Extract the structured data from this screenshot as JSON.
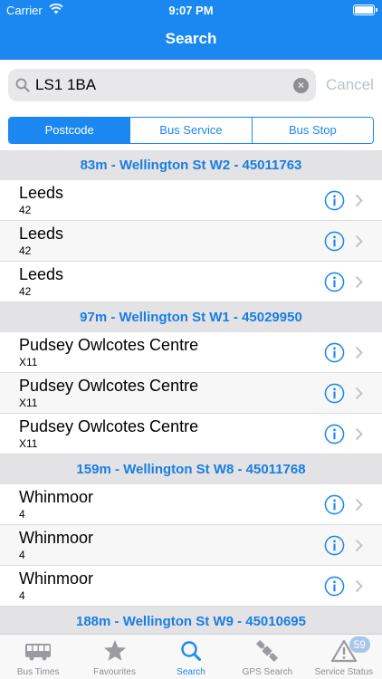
{
  "status_bar": {
    "carrier": "Carrier",
    "time": "9:07 PM"
  },
  "nav": {
    "title": "Search"
  },
  "search": {
    "value": "LS1 1BA",
    "cancel": "Cancel",
    "clear_icon": "×"
  },
  "segments": [
    {
      "label": "Postcode",
      "active": true
    },
    {
      "label": "Bus Service",
      "active": false
    },
    {
      "label": "Bus Stop",
      "active": false
    }
  ],
  "sections": [
    {
      "header": "83m - Wellington St W2 - 45011763",
      "rows": [
        {
          "name": "Leeds",
          "route": "42"
        },
        {
          "name": "Leeds",
          "route": "42"
        },
        {
          "name": "Leeds",
          "route": "42"
        }
      ]
    },
    {
      "header": "97m - Wellington St W1 - 45029950",
      "rows": [
        {
          "name": "Pudsey Owlcotes Centre",
          "route": "X11"
        },
        {
          "name": "Pudsey Owlcotes Centre",
          "route": "X11"
        },
        {
          "name": "Pudsey Owlcotes Centre",
          "route": "X11"
        }
      ]
    },
    {
      "header": "159m - Wellington St W8 - 45011768",
      "rows": [
        {
          "name": "Whinmoor",
          "route": "4"
        },
        {
          "name": "Whinmoor",
          "route": "4"
        },
        {
          "name": "Whinmoor",
          "route": "4"
        }
      ]
    },
    {
      "header": "188m - Wellington St W9 - 45010695",
      "rows": []
    }
  ],
  "tabs": [
    {
      "label": "Bus Times",
      "icon": "bus-icon",
      "active": false
    },
    {
      "label": "Favourites",
      "icon": "star-icon",
      "active": false
    },
    {
      "label": "Search",
      "icon": "search-icon",
      "active": true
    },
    {
      "label": "GPS Search",
      "icon": "satellite-icon",
      "active": false
    },
    {
      "label": "Service Status",
      "icon": "warning-icon",
      "active": false,
      "badge": "59"
    }
  ],
  "colors": {
    "accent": "#1a88f0",
    "section_bg": "#e3e3e6",
    "section_text": "#1a7ee0"
  }
}
